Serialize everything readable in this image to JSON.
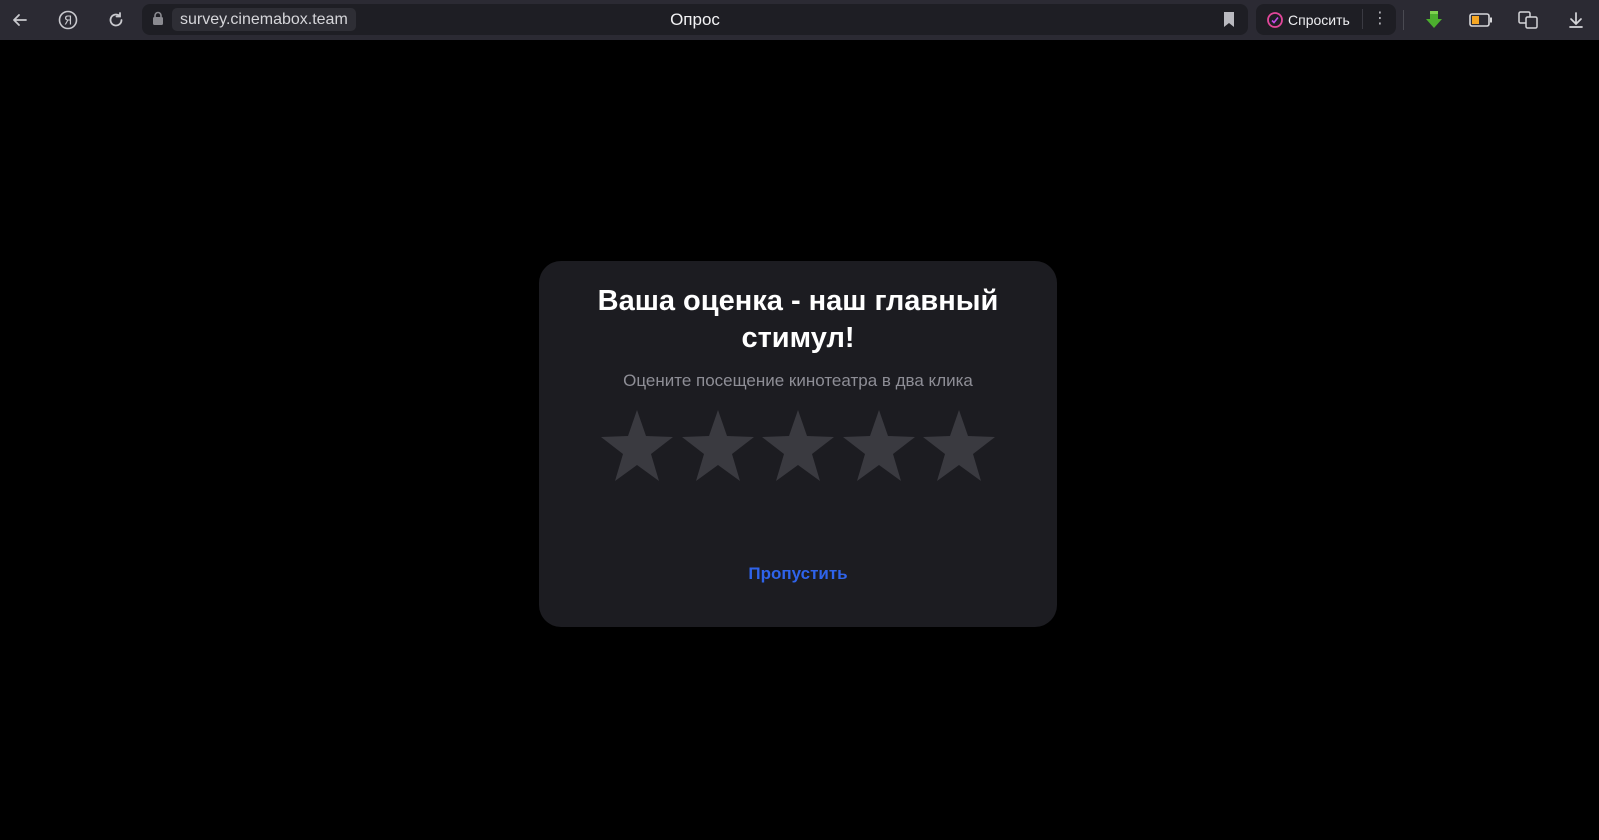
{
  "browser": {
    "url": "survey.cinemabox.team",
    "page_title": "Опрос",
    "ask_label": "Спросить",
    "ask_menu_icon": "more-vertical-icon",
    "icons": [
      "back-arrow-icon",
      "yandex-logo-icon",
      "reload-icon",
      "lock-icon",
      "bookmark-icon",
      "ask-ai-icon",
      "extension-download-green-icon",
      "battery-saver-icon",
      "translate-icon",
      "downloads-icon"
    ]
  },
  "survey": {
    "title": "Ваша оценка - наш главный стимул!",
    "subtitle": "Оцените посещение кинотеатра в два клика",
    "rating_max": 5,
    "rating_value": 0,
    "skip_label": "Пропустить"
  },
  "colors": {
    "page_bg": "#000000",
    "card_bg": "#1c1c21",
    "star_empty": "#3a3a40",
    "link": "#2f63ea",
    "browser_bar": "#2b2a33"
  }
}
